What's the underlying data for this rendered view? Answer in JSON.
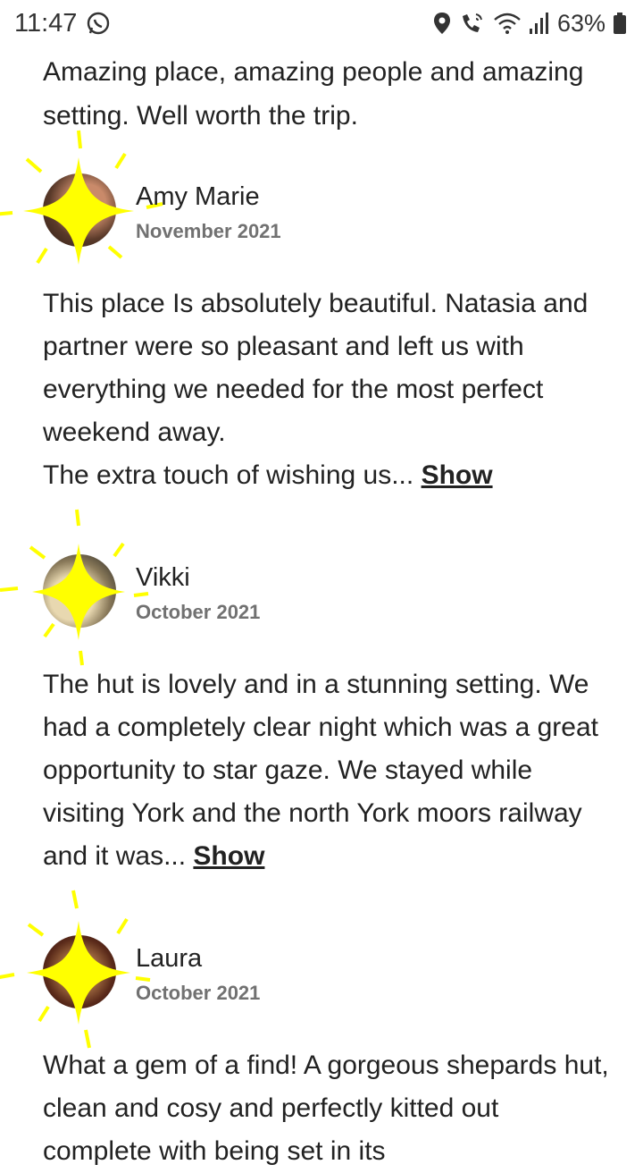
{
  "status_bar": {
    "time": "11:47",
    "battery": "63%",
    "icons": [
      "whatsapp-icon",
      "location-icon",
      "wifi-calling-icon",
      "wifi-icon",
      "signal-icon",
      "battery-icon"
    ]
  },
  "intro_text": "Amazing place, amazing people and amazing setting. Well worth the trip.",
  "reviews": [
    {
      "name": "Amy Marie",
      "date": "November 2021",
      "text": "This place Is absolutely beautiful. Natasia and partner were so pleasant and left us with everything we needed for the most perfect weekend away.",
      "text2": "The extra touch of wishing us...",
      "show_label": "Show"
    },
    {
      "name": "Vikki",
      "date": "October 2021",
      "text": "The hut is lovely and in a stunning setting. We had a completely clear night which was a great opportunity to star gaze. We stayed while visiting York and the north York moors railway and it was...",
      "show_label": "Show"
    },
    {
      "name": "Laura",
      "date": "October 2021",
      "text": "What a gem of a find! A gorgeous shepards hut, clean and cosy and perfectly kitted out complete with being set in its"
    }
  ],
  "colors": {
    "text": "#222222",
    "secondary": "#717171",
    "sparkle": "#ffff00"
  }
}
